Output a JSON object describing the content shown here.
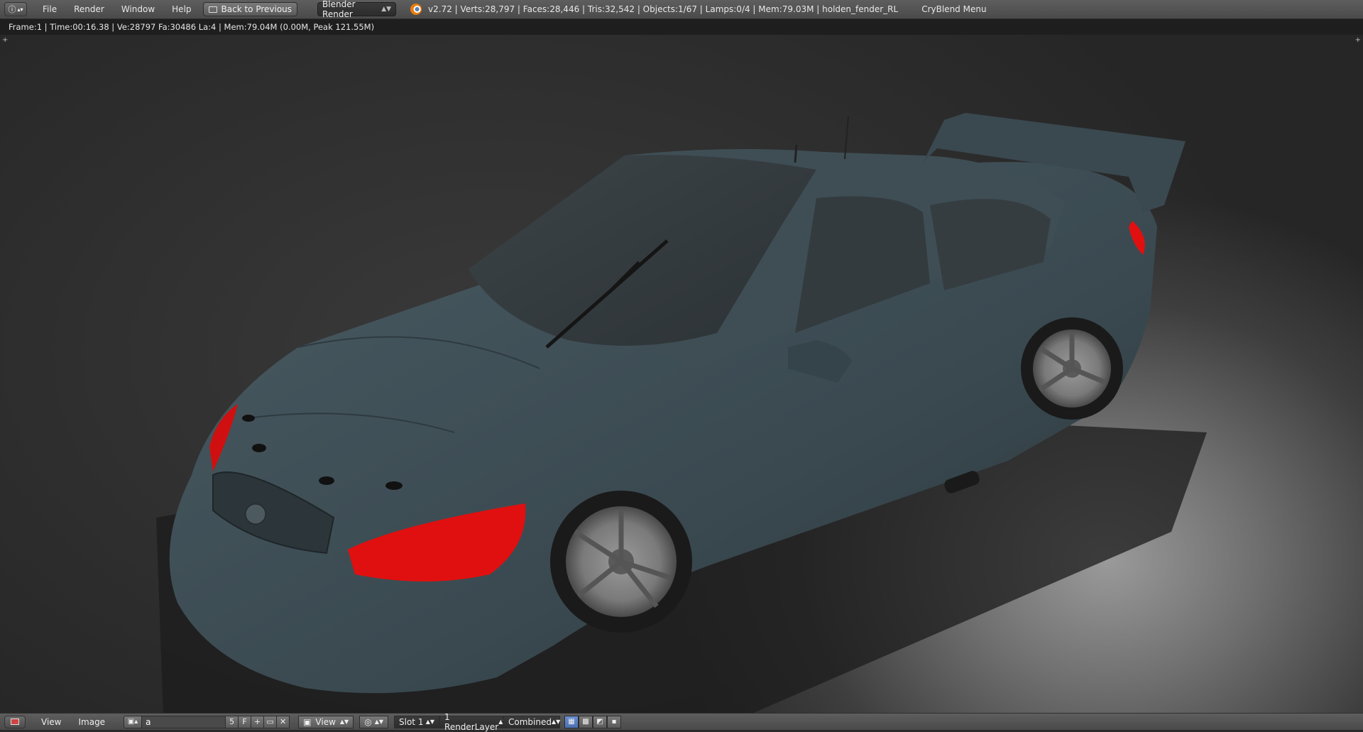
{
  "topbar": {
    "editor_icon": "ⓘ",
    "menus": [
      "File",
      "Render",
      "Window",
      "Help"
    ],
    "back_button": "Back to Previous",
    "render_engine": "Blender Render",
    "stats": "v2.72 | Verts:28,797 | Faces:28,446 | Tris:32,542 | Objects:1/67 | Lamps:0/4 | Mem:79.03M | holden_fender_RL",
    "cryblend_menu": "CryBlend Menu"
  },
  "infobar": {
    "render_info": "Frame:1 | Time:00:16.38 | Ve:28797 Fa:30486 La:4 | Mem:79.04M (0.00M, Peak 121.55M)"
  },
  "bottombar": {
    "menus": [
      "View",
      "Image"
    ],
    "image_name": "a",
    "users_count": "5",
    "fake_user": "F",
    "view_dropdown": "View",
    "slot": "Slot 1",
    "render_layer": "1 RenderLayer",
    "pass": "Combined"
  },
  "colors": {
    "car_body": "#3b4b52",
    "headlight": "#e01010",
    "background": "#2a2a2a"
  }
}
